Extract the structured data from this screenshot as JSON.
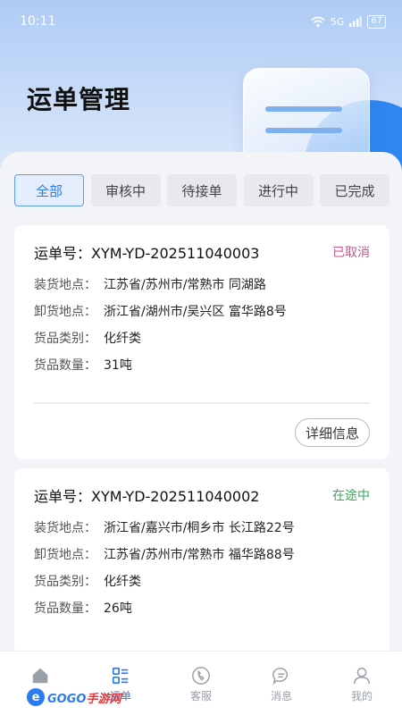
{
  "status_bar": {
    "time": "10:11",
    "signal_label": "5G",
    "battery": "67"
  },
  "header": {
    "title": "运单管理"
  },
  "tabs": [
    {
      "label": "全部",
      "active": true
    },
    {
      "label": "审核中",
      "active": false
    },
    {
      "label": "待接单",
      "active": false
    },
    {
      "label": "进行中",
      "active": false
    },
    {
      "label": "已完成",
      "active": false
    }
  ],
  "labels": {
    "waybill_prefix": "运单号：",
    "loading": "装货地点：",
    "unloading": "卸货地点：",
    "goods_type": "货品类别：",
    "goods_qty": "货品数量："
  },
  "orders": [
    {
      "waybill_no": "XYM-YD-202511040003",
      "status": "已取消",
      "status_color": "#c5578f",
      "loading_place": "江苏省/苏州市/常熟市 同湖路",
      "unloading_place": "浙江省/湖州市/吴兴区 富华路8号",
      "goods_type": "化纤类",
      "goods_qty": "31吨",
      "detail_label": "详细信息"
    },
    {
      "waybill_no": "XYM-YD-202511040002",
      "status": "在途中",
      "status_color": "#3aa65c",
      "loading_place": "浙江省/嘉兴市/桐乡市 长江路22号",
      "unloading_place": "江苏省/苏州市/常熟市 福华路88号",
      "goods_type": "化纤类",
      "goods_qty": "26吨"
    }
  ],
  "bottom_nav": [
    {
      "label": "",
      "icon": "home-icon",
      "active": false
    },
    {
      "label": "运单",
      "icon": "list-icon",
      "active": true
    },
    {
      "label": "客服",
      "icon": "phone-icon",
      "active": false
    },
    {
      "label": "消息",
      "icon": "message-icon",
      "active": false
    },
    {
      "label": "我的",
      "icon": "user-icon",
      "active": false
    }
  ],
  "watermark": {
    "logo_letter": "e",
    "text_a": "GOGO",
    "text_b": "手游网"
  },
  "colors": {
    "accent": "#2b7cf0",
    "cancelled": "#c5578f",
    "in_transit": "#3aa65c"
  }
}
